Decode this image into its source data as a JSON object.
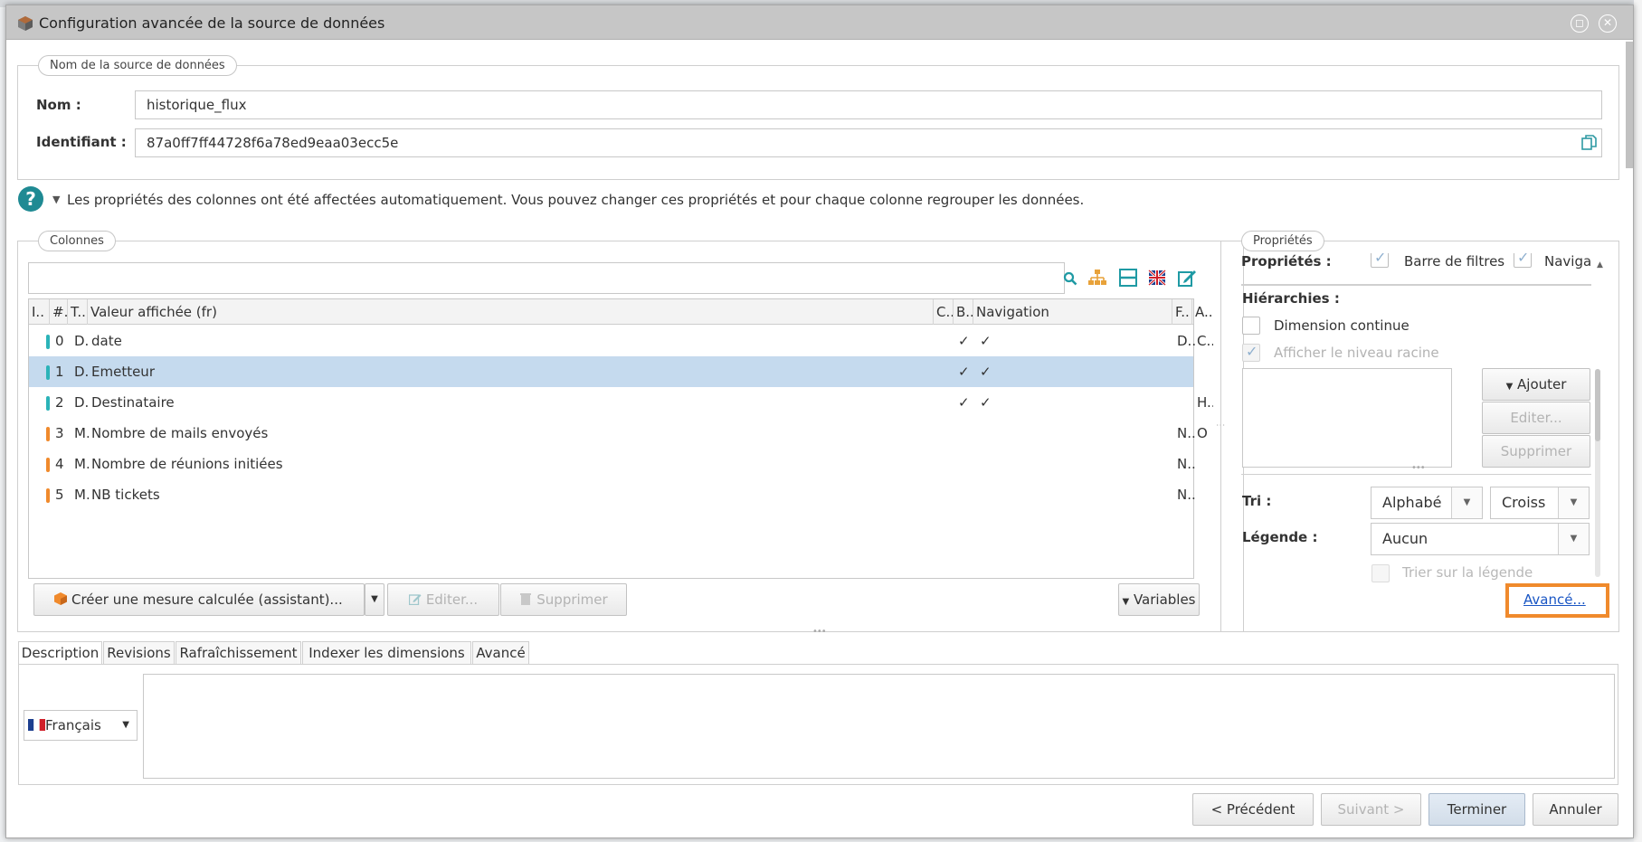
{
  "window": {
    "title": "Configuration avancée de la source de données",
    "restore_symbol": "◻",
    "close_symbol": "✕"
  },
  "name_section": {
    "legend": "Nom de la source de données",
    "nom_label": "Nom :",
    "nom_value": "historique_flux",
    "id_label": "Identifiant :",
    "id_value": "87a0ff7ff44728f6a78ed9eaa03ecc5e"
  },
  "info": {
    "text": "Les propriétés des colonnes ont été affectées automatiquement. Vous pouvez changer ces propriétés et pour chaque colonne regrouper les données."
  },
  "columns_section": {
    "legend": "Colonnes",
    "headers": {
      "i": "I..",
      "num": "#.",
      "type": "T..",
      "display": "Valeur affichée (fr)",
      "c": "C..",
      "b": "B..",
      "nav": "Navigation",
      "f": "F..",
      "a": "A.."
    },
    "rows": [
      {
        "num": "0",
        "type": "D.",
        "name": "date",
        "b": "✓",
        "nav": "✓",
        "f": "D..",
        "a": "C..",
        "color": "#2bb3b8",
        "selected": false
      },
      {
        "num": "1",
        "type": "D.",
        "name": "Emetteur",
        "b": "✓",
        "nav": "✓",
        "f": "",
        "a": "",
        "color": "#2bb3b8",
        "selected": true
      },
      {
        "num": "2",
        "type": "D.",
        "name": "Destinataire",
        "b": "✓",
        "nav": "✓",
        "f": "",
        "a": "H..",
        "color": "#2bb3b8",
        "selected": false
      },
      {
        "num": "3",
        "type": "M.",
        "name": "Nombre de mails envoyés",
        "b": "",
        "nav": "",
        "f": "N..",
        "a": "O",
        "color": "#f08a2c",
        "selected": false
      },
      {
        "num": "4",
        "type": "M.",
        "name": "Nombre de réunions initiées",
        "b": "",
        "nav": "",
        "f": "N..",
        "a": "",
        "color": "#f08a2c",
        "selected": false
      },
      {
        "num": "5",
        "type": "M.",
        "name": "NB tickets",
        "b": "",
        "nav": "",
        "f": "N..",
        "a": "",
        "color": "#f08a2c",
        "selected": false
      }
    ],
    "create_button": "Créer une mesure calculée (assistant)...",
    "edit_button": "Editer...",
    "delete_button": "Supprimer",
    "variables_button": "Variables"
  },
  "properties_section": {
    "legend": "Propriétés",
    "cut_label": "Propriétés :",
    "cut_filter": "Barre de filtres",
    "cut_nav": "Naviga",
    "hierarchies_label": "Hiérarchies :",
    "dimension_continue": "Dimension continue",
    "afficher_racine": "Afficher le niveau racine",
    "ajouter_button": "Ajouter",
    "editer_button": "Editer...",
    "supprimer_button": "Supprimer",
    "tri_label": "Tri :",
    "tri_value1": "Alphabé",
    "tri_value2": "Croiss",
    "legende_label": "Légende :",
    "legende_value": "Aucun",
    "trier_legende": "Trier sur la légende",
    "avance_link": "Avancé..."
  },
  "tabs": [
    "Description",
    "Revisions",
    "Rafraîchissement",
    "Indexer les dimensions",
    "Avancé"
  ],
  "description": {
    "language": "Français"
  },
  "footer": {
    "precedent": "< Précédent",
    "suivant": "Suivant >",
    "terminer": "Terminer",
    "annuler": "Annuler"
  },
  "colors": {
    "dimension": "#2bb3b8",
    "measure": "#f08a2c",
    "selected_row": "#c5daee",
    "highlight": "#f08a2c",
    "link": "#1a56c4"
  }
}
